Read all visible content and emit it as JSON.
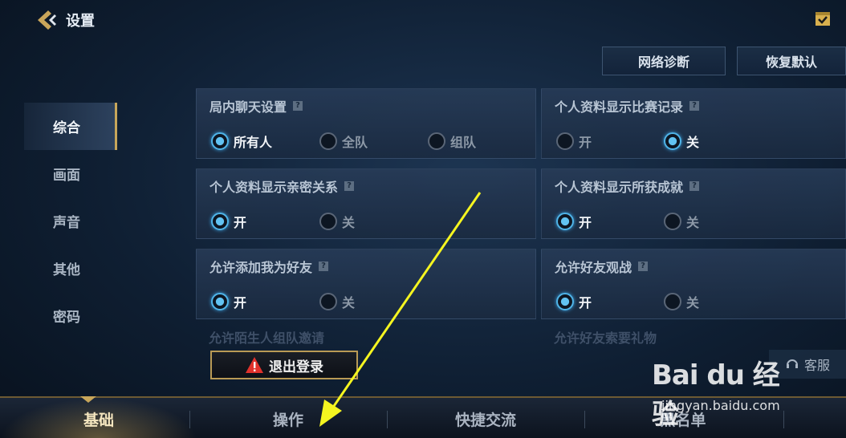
{
  "header": {
    "title": "设置"
  },
  "top_buttons": {
    "diagnose": "网络诊断",
    "reset": "恢复默认"
  },
  "sidebar": {
    "items": [
      {
        "label": "综合",
        "active": true
      },
      {
        "label": "画面",
        "active": false
      },
      {
        "label": "声音",
        "active": false
      },
      {
        "label": "其他",
        "active": false
      },
      {
        "label": "密码",
        "active": false
      }
    ]
  },
  "settings": {
    "chat": {
      "title": "局内聊天设置",
      "options": [
        "所有人",
        "全队",
        "组队"
      ],
      "selected": "所有人"
    },
    "match_record": {
      "title": "个人资料显示比赛记录",
      "options": [
        "开",
        "关"
      ],
      "selected": "关"
    },
    "intimacy": {
      "title": "个人资料显示亲密关系",
      "options": [
        "开",
        "关"
      ],
      "selected": "开"
    },
    "achievements": {
      "title": "个人资料显示所获成就",
      "options": [
        "开",
        "关"
      ],
      "selected": "开"
    },
    "add_friend": {
      "title": "允许添加我为好友",
      "options": [
        "开",
        "关"
      ],
      "selected": "开"
    },
    "spectate": {
      "title": "允许好友观战",
      "options": [
        "开",
        "关"
      ],
      "selected": "开"
    },
    "stranger_invite": {
      "title": "允许陌生人组队邀请"
    },
    "gift_request": {
      "title": "允许好友索要礼物"
    }
  },
  "help_mark": "?",
  "logout": {
    "label": "退出登录"
  },
  "support": {
    "label": "客服"
  },
  "bottom_tabs": [
    {
      "label": "基础",
      "active": true
    },
    {
      "label": "操作",
      "active": false
    },
    {
      "label": "快捷交流",
      "active": false
    },
    {
      "label": "黑名单",
      "active": false
    }
  ],
  "watermark": {
    "logo": "Bai du 经验",
    "url": "jingyan.baidu.com"
  },
  "colors": {
    "accent_gold": "#c8a65a",
    "radio_on": "#4fb4e8",
    "annotation_arrow": "#f5f520"
  }
}
